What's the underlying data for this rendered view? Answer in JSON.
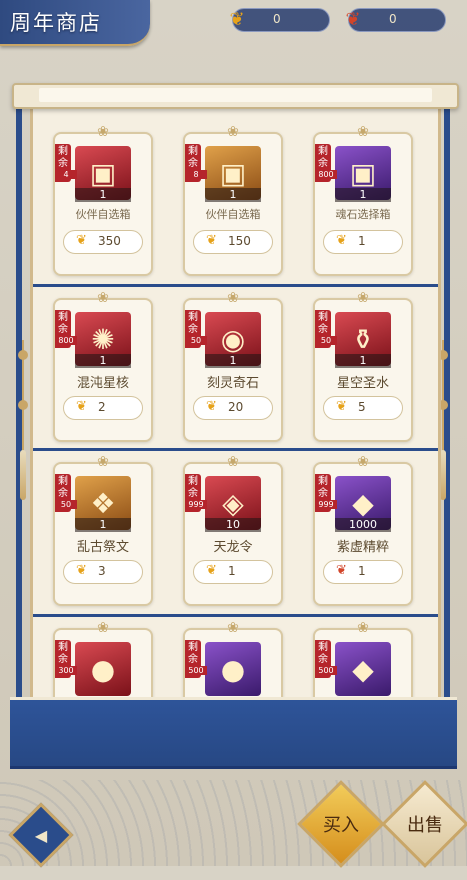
{
  "header": {
    "title": "周年商店",
    "currencies": [
      {
        "icon": "gold-leaf-icon",
        "value": "0",
        "color": "#e6a21a"
      },
      {
        "icon": "red-leaf-icon",
        "value": "0",
        "color": "#d2452a"
      }
    ]
  },
  "stock_label": "剩余",
  "rows": [
    [
      {
        "stock": "4",
        "name": "伙伴自选箱",
        "qty": "1",
        "price": "350",
        "icon": "treasure-chest-red-icon",
        "bg": "red"
      },
      {
        "stock": "8",
        "name": "伙伴自选箱",
        "qty": "1",
        "price": "150",
        "icon": "treasure-chest-gold-icon",
        "bg": "gold"
      },
      {
        "stock": "800",
        "name": "魂石选择箱",
        "qty": "1",
        "price": "1",
        "icon": "treasure-chest-green-icon",
        "bg": "purple"
      }
    ],
    [
      {
        "stock": "800",
        "name": "混沌星核",
        "qty": "1",
        "price": "2",
        "icon": "chaos-star-core-icon",
        "bg": "red"
      },
      {
        "stock": "50",
        "name": "刻灵奇石",
        "qty": "1",
        "price": "20",
        "icon": "spirit-stone-icon",
        "bg": "red"
      },
      {
        "stock": "50",
        "name": "星空圣水",
        "qty": "1",
        "price": "5",
        "icon": "holy-water-icon",
        "bg": "red"
      }
    ],
    [
      {
        "stock": "50",
        "name": "乱古祭文",
        "qty": "1",
        "price": "3",
        "icon": "ancient-scroll-icon",
        "bg": "gold"
      },
      {
        "stock": "999",
        "name": "天龙令",
        "qty": "10",
        "price": "1",
        "icon": "dragon-token-icon",
        "bg": "red"
      },
      {
        "stock": "999",
        "name": "紫虚精粹",
        "qty": "1000",
        "price": "1",
        "icon": "purple-crystal-icon",
        "bg": "purple",
        "price_icon": "red"
      }
    ],
    [
      {
        "stock": "300",
        "icon": "orb-icon",
        "bg": "red"
      },
      {
        "stock": "500",
        "icon": "violet-orb-icon",
        "bg": "purple"
      },
      {
        "stock": "500",
        "icon": "blue-gem-icon",
        "bg": "purple"
      }
    ]
  ],
  "buttons": {
    "buy": "买入",
    "sell": "出售"
  }
}
